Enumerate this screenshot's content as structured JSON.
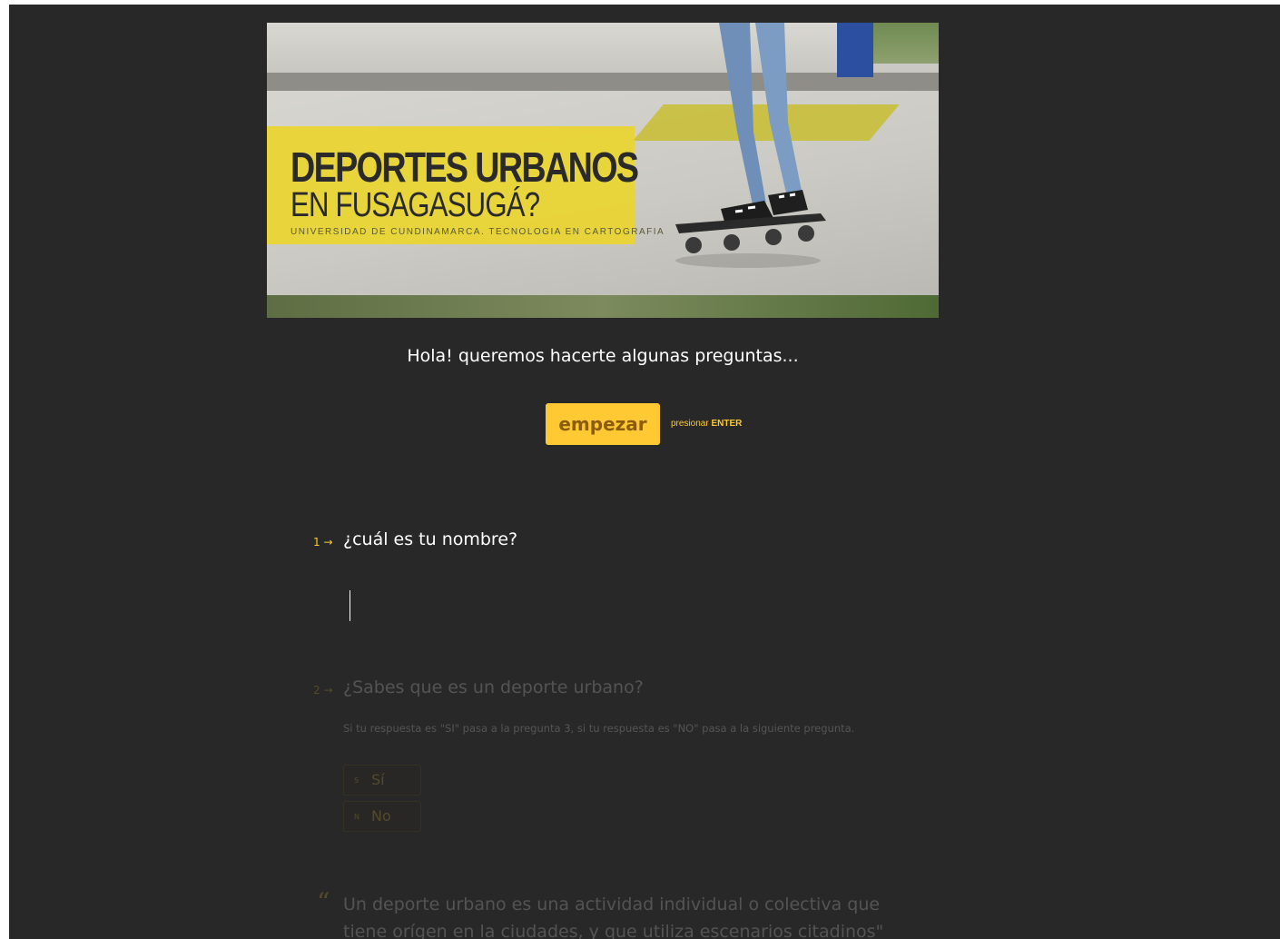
{
  "banner": {
    "title_line1": "DEPORTES URBANOS",
    "title_line2": "EN FUSAGASUGÁ?",
    "title_line3": "UNIVERSIDAD DE CUNDINAMARCA. TECNOLOGIA EN CARTOGRAFIA"
  },
  "welcome": {
    "message": "Hola! queremos hacerte algunas preguntas...",
    "start_label": "empezar",
    "hint_prefix": "presionar",
    "hint_key": "ENTER"
  },
  "questions": [
    {
      "number": "1",
      "arrow": "→",
      "text": "¿cuál es tu nombre?",
      "answer": ""
    },
    {
      "number": "2",
      "arrow": "→",
      "text": "¿Sabes que es un deporte urbano?",
      "description": "Si tu respuesta es \"SI\" pasa a la pregunta 3, si tu respuesta es \"NO\" pasa a la siguiente pregunta.",
      "choices": [
        {
          "key": "S",
          "label": "Sí"
        },
        {
          "key": "N",
          "label": "No"
        }
      ]
    }
  ],
  "quote": {
    "mark": "“",
    "text": "Un deporte urbano es una actividad individual o colectiva que tiene orígen en la ciudades, y que utiliza escenarios citadinos\""
  },
  "colors": {
    "accent": "#fec933",
    "background": "#282828",
    "button_text": "#8a5c0b"
  }
}
